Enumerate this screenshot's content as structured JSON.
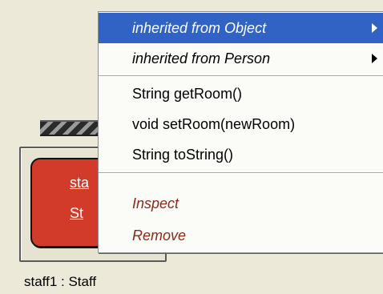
{
  "object_bench": {
    "object_line1": "sta",
    "object_line2": "St",
    "caption": "staff1 : Staff"
  },
  "context_menu": {
    "submenus": [
      {
        "label": "inherited from Object",
        "selected": true
      },
      {
        "label": "inherited from Person",
        "selected": false
      }
    ],
    "methods": [
      {
        "label": "String getRoom()"
      },
      {
        "label": "void setRoom(newRoom)"
      },
      {
        "label": "String toString()"
      }
    ],
    "actions": [
      {
        "label": "Inspect"
      },
      {
        "label": "Remove"
      }
    ]
  },
  "colors": {
    "selection": "#3163c4",
    "object_fill": "#d23b2a",
    "action_text": "#8a2a1a"
  }
}
